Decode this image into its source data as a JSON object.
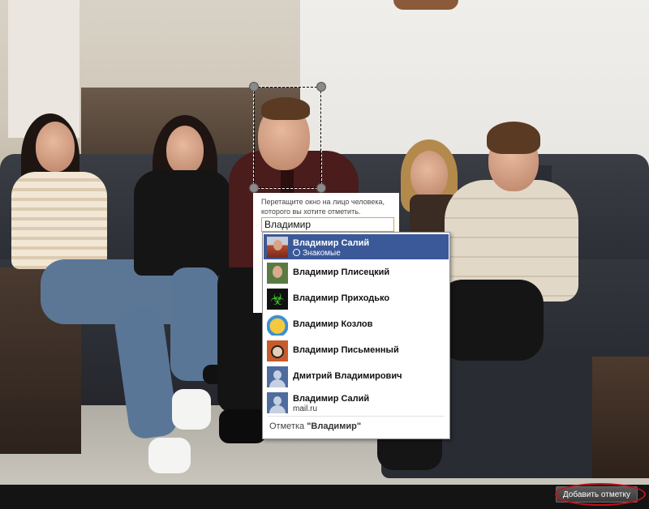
{
  "tagger": {
    "instruction": "Перетащите окно на лицо человека, которого вы хотите отметить.",
    "input_value": "Владимир",
    "suggestions": [
      {
        "name": "Владимир Салий",
        "subtitle": "Знакомые",
        "avatar": "friend-photo-avatar",
        "selected": true
      },
      {
        "name": "Владимир Плисецкий",
        "subtitle": "",
        "avatar": "friend-photo-avatar",
        "selected": false
      },
      {
        "name": "Владимир Приходько",
        "subtitle": "",
        "avatar": "biohazard-avatar",
        "selected": false
      },
      {
        "name": "Владимир Козлов",
        "subtitle": "",
        "avatar": "cartoon-avatar",
        "selected": false
      },
      {
        "name": "Владимир Письменный",
        "subtitle": "",
        "avatar": "friend-photo-avatar",
        "selected": false
      },
      {
        "name": "Дмитрий Владимирович",
        "subtitle": "",
        "avatar": "default-silhouette-avatar",
        "selected": false
      },
      {
        "name": "Владимир Салий",
        "subtitle": "mail.ru",
        "avatar": "default-silhouette-avatar",
        "selected": false
      }
    ],
    "tag_as_prefix": "Отметка ",
    "tag_as_value": "\"Владимир\""
  },
  "footer": {
    "add_tag_label": "Добавить отметку"
  },
  "colors": {
    "selection": "#3b5998",
    "input_border": "#e0a531",
    "highlight_ellipse": "#c4111b"
  }
}
